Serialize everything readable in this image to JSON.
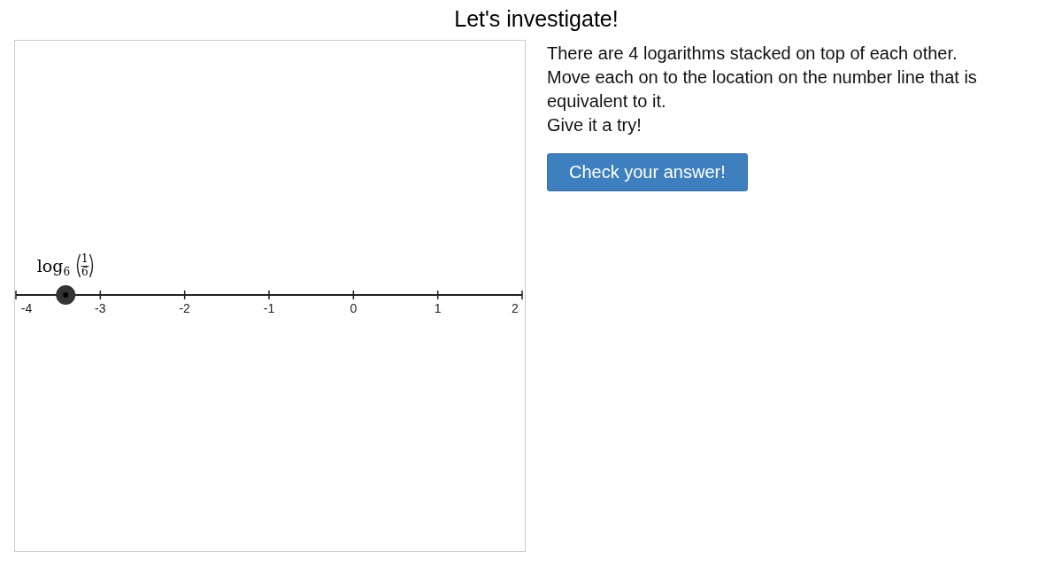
{
  "title": "Let's investigate!",
  "board": {
    "tick_labels": [
      "-4",
      "-3",
      "-2",
      "-1",
      "0",
      "1",
      "2"
    ],
    "point_label": {
      "function": "log",
      "base": "6",
      "numerator": "1",
      "denominator": "6"
    }
  },
  "instructions": [
    "There are 4 logarithms stacked on top of each other.",
    "Move each on to the location on the number line that is",
    "equivalent to it.",
    "Give it a try!"
  ],
  "button": "Check your answer!"
}
